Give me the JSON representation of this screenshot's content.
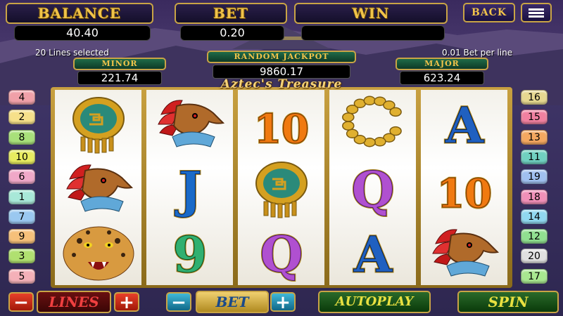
{
  "header": {
    "balance_label": "BALANCE",
    "balance_value": "40.40",
    "bet_label": "BET",
    "bet_value": "0.20",
    "win_label": "WIN",
    "win_value": "",
    "back_label": "BACK",
    "menu_icon": "hamburger-menu-icon"
  },
  "info": {
    "lines_selected": "20 Lines selected",
    "bet_per_line": "0.01 Bet per line"
  },
  "jackpots": {
    "random_label": "RANDOM JACKPOT",
    "random_value": "9860.17",
    "minor_label": "MINOR",
    "minor_value": "221.74",
    "major_label": "MAJOR",
    "major_value": "623.24"
  },
  "game_title": "Aztec's Treasure",
  "reels": [
    [
      "shield",
      "eagle-warrior",
      "jaguar"
    ],
    [
      "eagle-warrior",
      "J",
      "9"
    ],
    [
      "10",
      "shield",
      "Q"
    ],
    [
      "necklace",
      "Q",
      "A"
    ],
    [
      "A",
      "10",
      "eagle-warrior"
    ]
  ],
  "left_lines": [
    {
      "num": "4",
      "color": "#f0a0a8"
    },
    {
      "num": "2",
      "color": "#f6e08a"
    },
    {
      "num": "8",
      "color": "#a8e07a"
    },
    {
      "num": "10",
      "color": "#e8ec60"
    },
    {
      "num": "6",
      "color": "#f0a8c8"
    },
    {
      "num": "1",
      "color": "#a8e8d8"
    },
    {
      "num": "7",
      "color": "#9ac8f0"
    },
    {
      "num": "9",
      "color": "#f6c07a"
    },
    {
      "num": "3",
      "color": "#b0e070"
    },
    {
      "num": "5",
      "color": "#f4b0b8"
    }
  ],
  "right_lines": [
    {
      "num": "16",
      "color": "#e6d890"
    },
    {
      "num": "15",
      "color": "#f080a0"
    },
    {
      "num": "13",
      "color": "#f4a860"
    },
    {
      "num": "11",
      "color": "#70d0c0"
    },
    {
      "num": "19",
      "color": "#a0c0f0"
    },
    {
      "num": "18",
      "color": "#f090b8"
    },
    {
      "num": "14",
      "color": "#90d8f0"
    },
    {
      "num": "12",
      "color": "#90e090"
    },
    {
      "num": "20",
      "color": "#e0e0e0"
    },
    {
      "num": "17",
      "color": "#a8e890"
    }
  ],
  "controls": {
    "lines_label": "LINES",
    "bet_label": "BET",
    "autoplay_label": "AUTOPLAY",
    "spin_label": "SPIN",
    "minus": "−",
    "plus": "+"
  }
}
